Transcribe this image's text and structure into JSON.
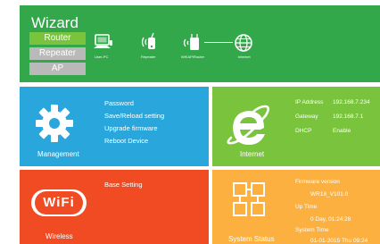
{
  "wizard": {
    "title": "Wizard",
    "modes": [
      "Router",
      "Repeater",
      "AP"
    ],
    "active_mode": "Router",
    "topology": {
      "user_pc": "User-PC",
      "repeater": "Repeater",
      "wifi_router": "Wifi AP/Router",
      "internet": "Internet"
    }
  },
  "management": {
    "label": "Management",
    "links": [
      "Password",
      "Save/Reload setting",
      "Upgrade firmware",
      "Reboot Device"
    ]
  },
  "internet": {
    "label": "Internet",
    "ip_label": "IP Address",
    "ip_value": "192.168.7.234",
    "gateway_label": "Gateway",
    "gateway_value": "192.168.7.1",
    "dhcp_label": "DHCP",
    "dhcp_value": "Enable"
  },
  "wireless": {
    "label": "Wireless",
    "logo_text": "WiFi",
    "links": [
      "Base Setting"
    ]
  },
  "status": {
    "label": "System Status",
    "firmware_label": "Firmware version",
    "firmware_value": "WR18_V101.0",
    "uptime_label": "Up Time",
    "uptime_value": "0 Day, 01:24:28",
    "systime_label": "System Time",
    "systime_value": "01-01-2015 Thu 09:24"
  },
  "colors": {
    "wizard_bg": "#33a84a",
    "active_mode": "#79c43c",
    "inactive_mode": "#b9b9b9",
    "management": "#29a7dc",
    "internet": "#79c43c",
    "wireless": "#f04b23",
    "status": "#fbb040"
  }
}
